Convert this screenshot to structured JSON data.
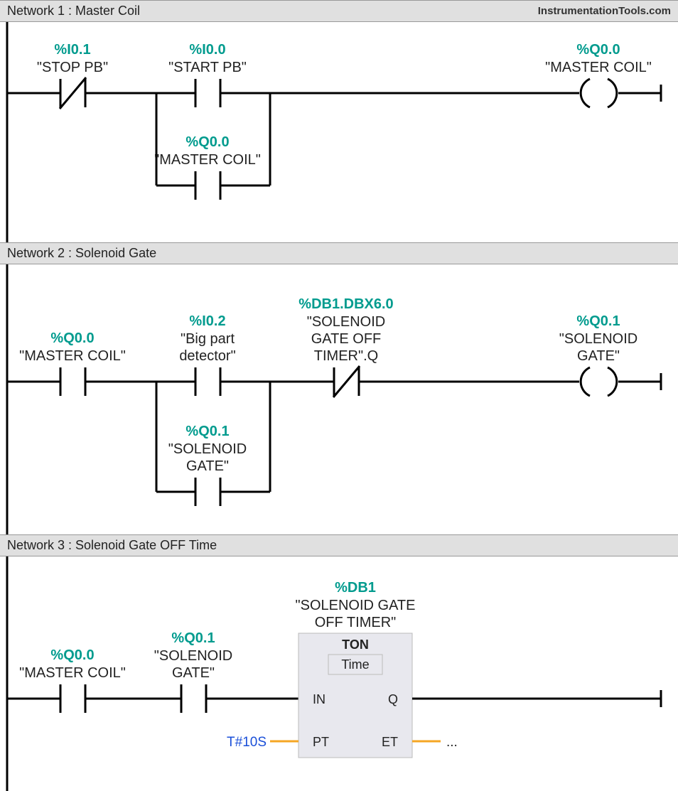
{
  "watermark": "InstrumentationTools.com",
  "networks": [
    {
      "title": "Network 1 : Master Coil",
      "elements": {
        "c1": {
          "addr": "%I0.1",
          "label": "\"STOP PB\""
        },
        "c2": {
          "addr": "%I0.0",
          "label": "\"START PB\""
        },
        "c3": {
          "addr": "%Q0.0",
          "label": "\"MASTER COIL\""
        },
        "coil": {
          "addr": "%Q0.0",
          "label": "\"MASTER COIL\""
        }
      }
    },
    {
      "title": "Network 2 : Solenoid Gate",
      "elements": {
        "c1": {
          "addr": "%Q0.0",
          "label": "\"MASTER COIL\""
        },
        "c2": {
          "addr": "%I0.2",
          "label1": "\"Big part",
          "label2": "detector\""
        },
        "c3": {
          "addr": "%DB1.DBX6.0",
          "label1": "\"SOLENOID",
          "label2": "GATE OFF",
          "label3": "TIMER\".Q"
        },
        "c4": {
          "addr": "%Q0.1",
          "label1": "\"SOLENOID",
          "label2": "GATE\""
        },
        "coil": {
          "addr": "%Q0.1",
          "label1": "\"SOLENOID",
          "label2": "GATE\""
        }
      }
    },
    {
      "title": "Network 3 : Solenoid Gate OFF Time",
      "elements": {
        "c1": {
          "addr": "%Q0.0",
          "label": "\"MASTER COIL\""
        },
        "c2": {
          "addr": "%Q0.1",
          "label1": "\"SOLENOID",
          "label2": "GATE\""
        },
        "fb": {
          "addr": "%DB1",
          "label1": "\"SOLENOID GATE",
          "label2": "OFF TIMER\"",
          "type": "TON",
          "sub": "Time",
          "in": "IN",
          "q": "Q",
          "pt": "PT",
          "et": "ET",
          "pt_val": "T#10S",
          "et_val": "..."
        }
      }
    }
  ]
}
